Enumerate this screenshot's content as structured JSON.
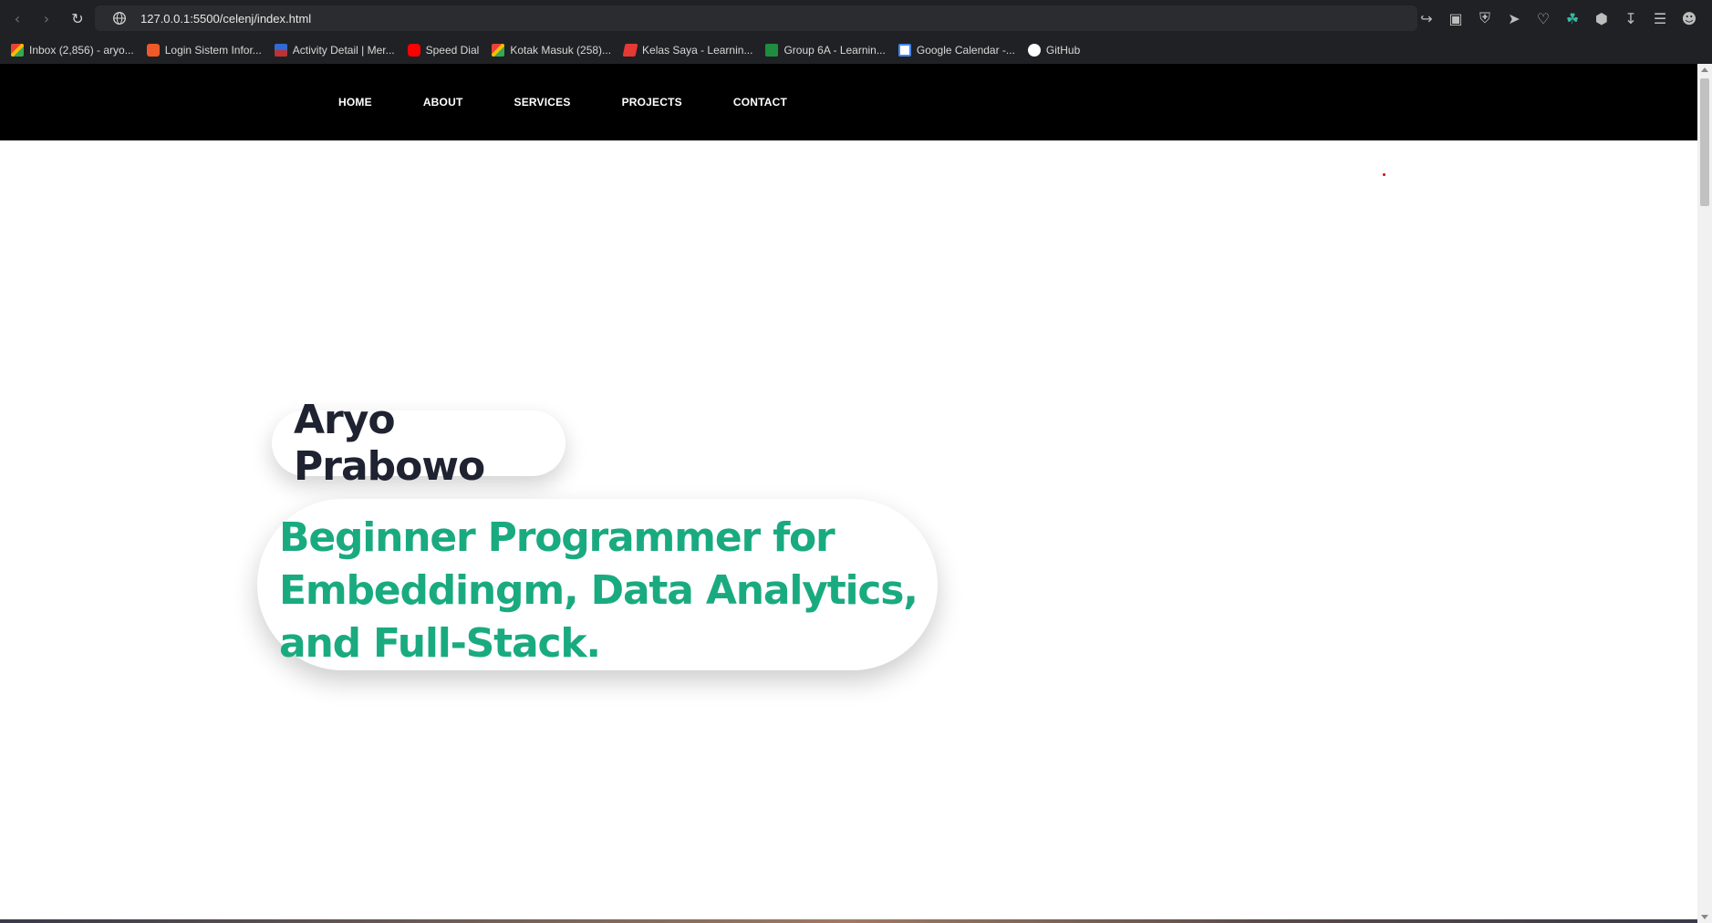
{
  "browser": {
    "url": "127.0.0.1:5500/celenj/index.html",
    "bookmarks": [
      {
        "label": "Inbox (2,856) - aryo...",
        "icon": "gmail-icon"
      },
      {
        "label": "Login Sistem Infor...",
        "icon": "orange-app-icon"
      },
      {
        "label": "Activity Detail | Mer...",
        "icon": "flag-icon"
      },
      {
        "label": "Speed Dial",
        "icon": "youtube-icon"
      },
      {
        "label": "Kotak Masuk (258)...",
        "icon": "gmail-icon"
      },
      {
        "label": "Kelas Saya - Learnin...",
        "icon": "kelas-icon"
      },
      {
        "label": "Group 6A - Learnin...",
        "icon": "classroom-icon"
      },
      {
        "label": "Google Calendar -...",
        "icon": "calendar-icon"
      },
      {
        "label": "GitHub",
        "icon": "github-icon"
      }
    ]
  },
  "site": {
    "nav": [
      "HOME",
      "ABOUT",
      "SERVICES",
      "PROJECTS",
      "CONTACT"
    ],
    "hero": {
      "name": "Aryo Prabowo",
      "tagline": "Beginner Programmer for Embeddingm, Data Analytics, and Full-Stack."
    }
  },
  "colors": {
    "accent": "#1aaa80",
    "nav_bg": "#000000",
    "name_text": "#1f2230"
  }
}
